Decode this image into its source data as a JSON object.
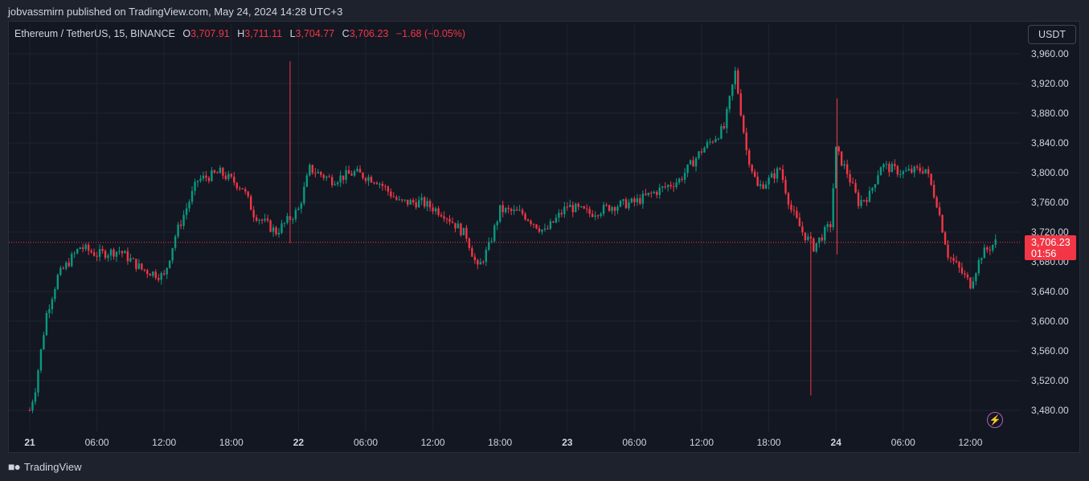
{
  "header": {
    "published_line": "jobvassmirn published on TradingView.com, May 24, 2024 14:28 UTC+3"
  },
  "legend": {
    "symbol": "Ethereum / TetherUS, 15, BINANCE",
    "o_label": "O",
    "o_value": "3,707.91",
    "h_label": "H",
    "h_value": "3,711.11",
    "l_label": "L",
    "l_value": "3,704.77",
    "c_label": "C",
    "c_value": "3,706.23",
    "change": "−1.68 (−0.05%)"
  },
  "currency_button": "USDT",
  "last_price": {
    "value": "3,706.23",
    "countdown": "01:56"
  },
  "footer": {
    "brand": "TradingView",
    "logo_icon": "tradingview-logo-icon"
  },
  "colors": {
    "up": "#089981",
    "down": "#f23645",
    "background": "#131722",
    "grid": "#1f2330",
    "text": "#d1d4dc",
    "accent": "#b45cc7"
  },
  "chart_data": {
    "type": "candlestick",
    "y_ticks": [
      "3,960.00",
      "3,920.00",
      "3,880.00",
      "3,840.00",
      "3,800.00",
      "3,760.00",
      "3,720.00",
      "3,680.00",
      "3,640.00",
      "3,600.00",
      "3,560.00",
      "3,520.00",
      "3,480.00"
    ],
    "ylim": [
      3460,
      3975
    ],
    "x_ticks": [
      {
        "label": "21",
        "bold": true
      },
      {
        "label": "06:00"
      },
      {
        "label": "12:00"
      },
      {
        "label": "18:00"
      },
      {
        "label": "22",
        "bold": true
      },
      {
        "label": "06:00"
      },
      {
        "label": "12:00"
      },
      {
        "label": "18:00"
      },
      {
        "label": "23",
        "bold": true
      },
      {
        "label": "06:00"
      },
      {
        "label": "12:00"
      },
      {
        "label": "18:00"
      },
      {
        "label": "24",
        "bold": true
      },
      {
        "label": "06:00"
      },
      {
        "label": "12:00"
      }
    ],
    "last_close": 3706.23,
    "interval": "15",
    "series": [
      {
        "time": "21 00:00",
        "close": 3480
      },
      {
        "time": "21 00:30",
        "close": 3510
      },
      {
        "time": "21 01:30",
        "close": 3610
      },
      {
        "time": "21 02:30",
        "close": 3660
      },
      {
        "time": "21 03:30",
        "close": 3680
      },
      {
        "time": "21 04:30",
        "close": 3700
      },
      {
        "time": "21 06:00",
        "close": 3690
      },
      {
        "time": "21 08:00",
        "close": 3695
      },
      {
        "time": "21 10:00",
        "close": 3670
      },
      {
        "time": "21 12:00",
        "close": 3660
      },
      {
        "time": "21 13:00",
        "close": 3715
      },
      {
        "time": "21 15:00",
        "close": 3790
      },
      {
        "time": "21 17:00",
        "close": 3800
      },
      {
        "time": "21 19:00",
        "close": 3780
      },
      {
        "time": "21 20:00",
        "close": 3745
      },
      {
        "time": "21 22:00",
        "close": 3720
      },
      {
        "time": "22 00:00",
        "close": 3750
      },
      {
        "time": "22 01:00",
        "close": 3805
      },
      {
        "time": "22 03:00",
        "close": 3790
      },
      {
        "time": "22 05:00",
        "close": 3800
      },
      {
        "time": "22 07:00",
        "close": 3790
      },
      {
        "time": "22 09:00",
        "close": 3760
      },
      {
        "time": "22 11:00",
        "close": 3760
      },
      {
        "time": "22 13:00",
        "close": 3745
      },
      {
        "time": "22 15:00",
        "close": 3715
      },
      {
        "time": "22 16:00",
        "close": 3670
      },
      {
        "time": "22 17:00",
        "close": 3700
      },
      {
        "time": "22 18:00",
        "close": 3750
      },
      {
        "time": "22 20:00",
        "close": 3745
      },
      {
        "time": "22 22:00",
        "close": 3720
      },
      {
        "time": "23 00:00",
        "close": 3755
      },
      {
        "time": "23 02:00",
        "close": 3745
      },
      {
        "time": "23 04:00",
        "close": 3755
      },
      {
        "time": "23 06:00",
        "close": 3760
      },
      {
        "time": "23 08:00",
        "close": 3775
      },
      {
        "time": "23 10:00",
        "close": 3790
      },
      {
        "time": "23 12:00",
        "close": 3830
      },
      {
        "time": "23 14:00",
        "close": 3860
      },
      {
        "time": "23 15:00",
        "close": 3935
      },
      {
        "time": "23 16:00",
        "close": 3830
      },
      {
        "time": "23 17:00",
        "close": 3780
      },
      {
        "time": "23 18:00",
        "close": 3790
      },
      {
        "time": "23 19:00",
        "close": 3805
      },
      {
        "time": "23 20:00",
        "close": 3750
      },
      {
        "time": "23 21:00",
        "close": 3720
      },
      {
        "time": "23 22:00",
        "close": 3700
      },
      {
        "time": "23 23:30",
        "close": 3730
      },
      {
        "time": "24 00:00",
        "close": 3830
      },
      {
        "time": "24 01:00",
        "close": 3800
      },
      {
        "time": "24 02:00",
        "close": 3760
      },
      {
        "time": "24 03:00",
        "close": 3770
      },
      {
        "time": "24 04:00",
        "close": 3810
      },
      {
        "time": "24 06:00",
        "close": 3800
      },
      {
        "time": "24 08:00",
        "close": 3805
      },
      {
        "time": "24 09:00",
        "close": 3760
      },
      {
        "time": "24 10:00",
        "close": 3690
      },
      {
        "time": "24 11:00",
        "close": 3670
      },
      {
        "time": "24 12:00",
        "close": 3650
      },
      {
        "time": "24 13:00",
        "close": 3690
      },
      {
        "time": "24 14:15",
        "close": 3706.23
      }
    ]
  }
}
